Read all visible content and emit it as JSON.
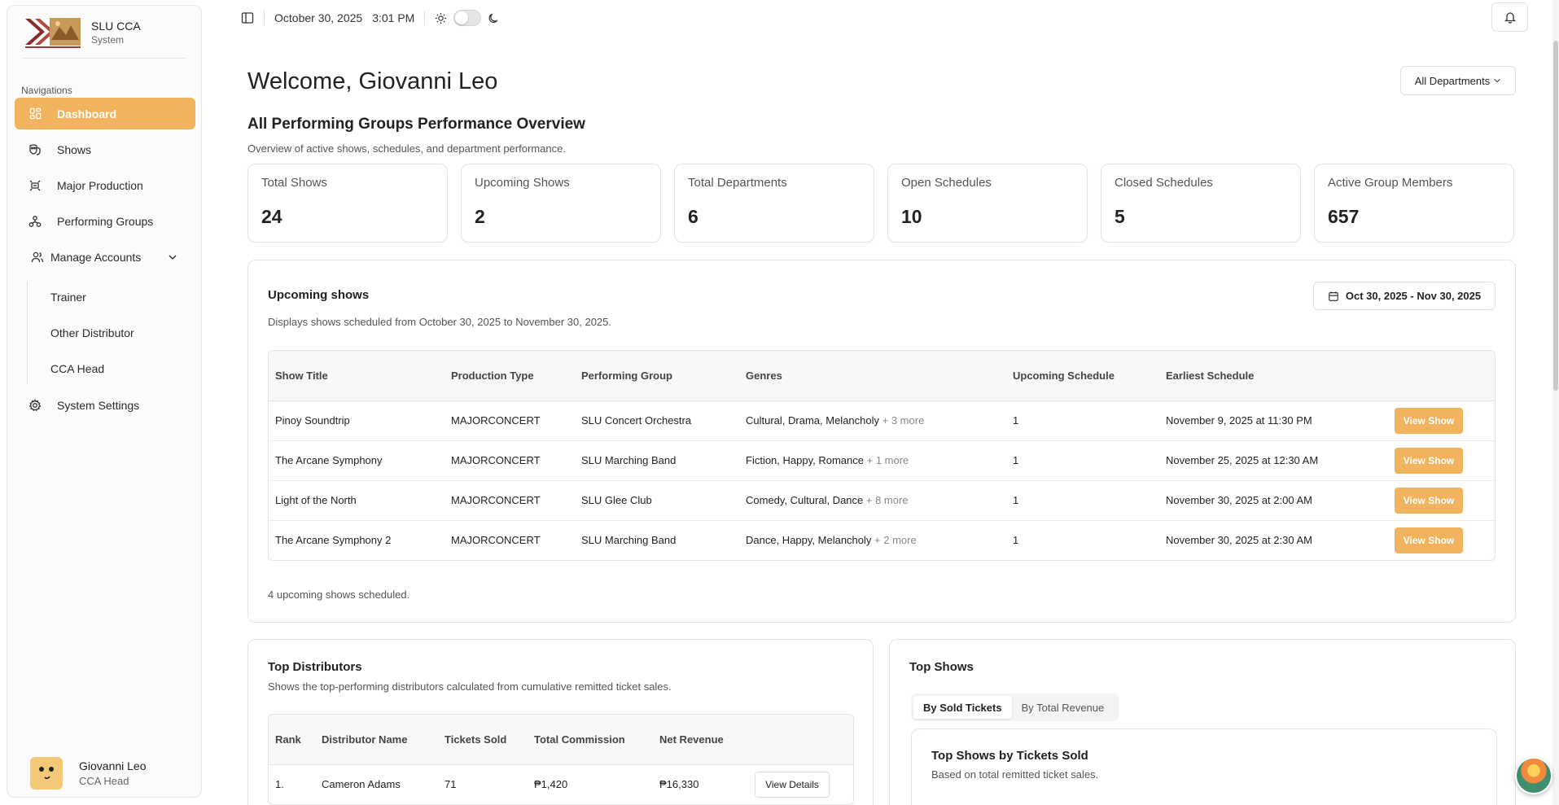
{
  "brand": {
    "name": "SLU CCA",
    "subtitle": "System",
    "logo_icon": "slu-cca-logo"
  },
  "nav": {
    "heading": "Navigations",
    "items": [
      {
        "label": "Dashboard",
        "icon": "dashboard-icon",
        "active": true
      },
      {
        "label": "Shows",
        "icon": "shows-icon"
      },
      {
        "label": "Major Production",
        "icon": "major-production-icon"
      },
      {
        "label": "Performing Groups",
        "icon": "groups-icon"
      },
      {
        "label": "Manage Accounts",
        "icon": "users-icon"
      },
      {
        "label": "System Settings",
        "icon": "gear-icon"
      }
    ],
    "sub_items": [
      "Trainer",
      "Other Distributor",
      "CCA Head"
    ]
  },
  "user": {
    "name": "Giovanni Leo",
    "role": "CCA Head"
  },
  "topbar": {
    "date": "October 30, 2025",
    "time": "3:01 PM"
  },
  "header": {
    "welcome": "Welcome, Giovanni Leo",
    "department_select": "All Departments",
    "title": "All Performing Groups Performance Overview",
    "subtitle": "Overview of active shows, schedules, and department performance."
  },
  "stats": [
    {
      "label": "Total Shows",
      "value": "24"
    },
    {
      "label": "Upcoming Shows",
      "value": "2"
    },
    {
      "label": "Total Departments",
      "value": "6"
    },
    {
      "label": "Open Schedules",
      "value": "10"
    },
    {
      "label": "Closed Schedules",
      "value": "5"
    },
    {
      "label": "Active Group Members",
      "value": "657"
    }
  ],
  "upcoming": {
    "title": "Upcoming shows",
    "subtitle": "Displays shows scheduled from October 30, 2025 to November 30, 2025.",
    "range": "Oct 30, 2025 - Nov 30, 2025",
    "columns": [
      "Show Title",
      "Production Type",
      "Performing Group",
      "Genres",
      "Upcoming Schedule",
      "Earliest Schedule",
      ""
    ],
    "rows": [
      {
        "title": "Pinoy Soundtrip",
        "type": "MAJORCONCERT",
        "group": "SLU Concert Orchestra",
        "genres": "Cultural, Drama, Melancholy",
        "more": "+ 3 more",
        "upcoming": "1",
        "earliest": "November 9, 2025 at 11:30 PM",
        "action": "View Show"
      },
      {
        "title": "The Arcane Symphony",
        "type": "MAJORCONCERT",
        "group": "SLU Marching Band",
        "genres": "Fiction, Happy, Romance",
        "more": "+ 1 more",
        "upcoming": "1",
        "earliest": "November 25, 2025 at 12:30 AM",
        "action": "View Show"
      },
      {
        "title": "Light of the North",
        "type": "MAJORCONCERT",
        "group": "SLU Glee Club",
        "genres": "Comedy, Cultural, Dance",
        "more": "+ 8 more",
        "upcoming": "1",
        "earliest": "November 30, 2025 at 2:00 AM",
        "action": "View Show"
      },
      {
        "title": "The Arcane Symphony 2",
        "type": "MAJORCONCERT",
        "group": "SLU Marching Band",
        "genres": "Dance, Happy, Melancholy",
        "more": "+ 2 more",
        "upcoming": "1",
        "earliest": "November 30, 2025 at 2:30 AM",
        "action": "View Show"
      }
    ],
    "count_text": "4 upcoming shows scheduled."
  },
  "distributors": {
    "title": "Top Distributors",
    "subtitle": "Shows the top-performing distributors calculated from cumulative remitted ticket sales.",
    "columns": [
      "Rank",
      "Distributor Name",
      "Tickets Sold",
      "Total Commission",
      "Net Revenue",
      ""
    ],
    "rows": [
      {
        "rank": "1.",
        "name": "Cameron Adams",
        "tickets": "71",
        "commission": "₱1,420",
        "revenue": "₱16,330",
        "action": "View Details"
      }
    ]
  },
  "top_shows": {
    "title": "Top Shows",
    "tabs": [
      "By Sold Tickets",
      "By Total Revenue"
    ],
    "inner_title": "Top Shows by Tickets Sold",
    "inner_subtitle": "Based on total remitted ticket sales."
  },
  "colors": {
    "accent": "#f2b35e",
    "border": "#e3e3e3"
  }
}
